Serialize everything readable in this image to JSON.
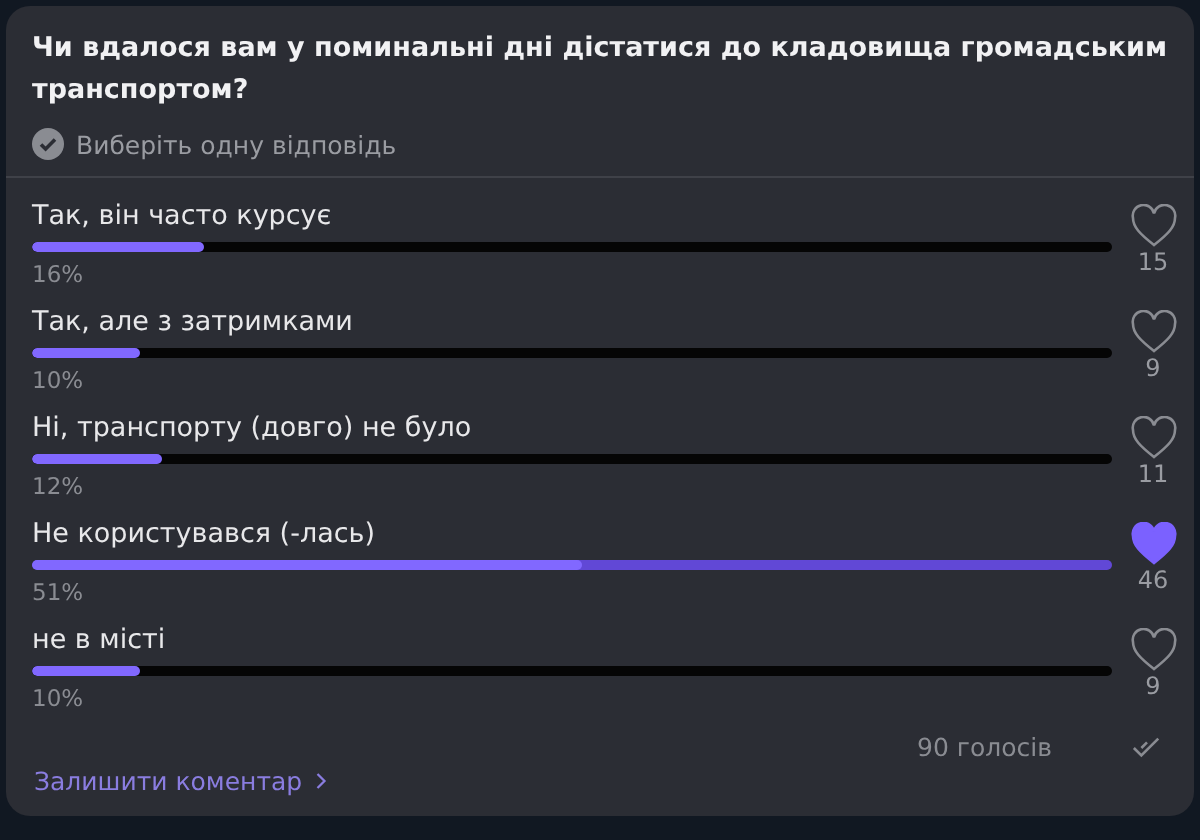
{
  "poll": {
    "question": "Чи вдалося вам у поминальні дні дістатися до кладовища громадським транспортом?",
    "hint": "Виберіть одну відповідь",
    "options": [
      {
        "label": "Так, він часто курсує",
        "percent": "16%",
        "level": 0.16,
        "votes": "15",
        "selected": false
      },
      {
        "label": "Так, але з затримками",
        "percent": "10%",
        "level": 0.1,
        "votes": "9",
        "selected": false
      },
      {
        "label": "Ні, транспорту (довго) не було",
        "percent": "12%",
        "level": 0.12,
        "votes": "11",
        "selected": false
      },
      {
        "label": "Не користувався (-лась)",
        "percent": "51%",
        "level": 0.51,
        "votes": "46",
        "selected": true
      },
      {
        "label": "не в місті",
        "percent": "10%",
        "level": 0.1,
        "votes": "9",
        "selected": false
      }
    ],
    "total": "90 голосів",
    "comment_link": "Залишити коментар"
  }
}
